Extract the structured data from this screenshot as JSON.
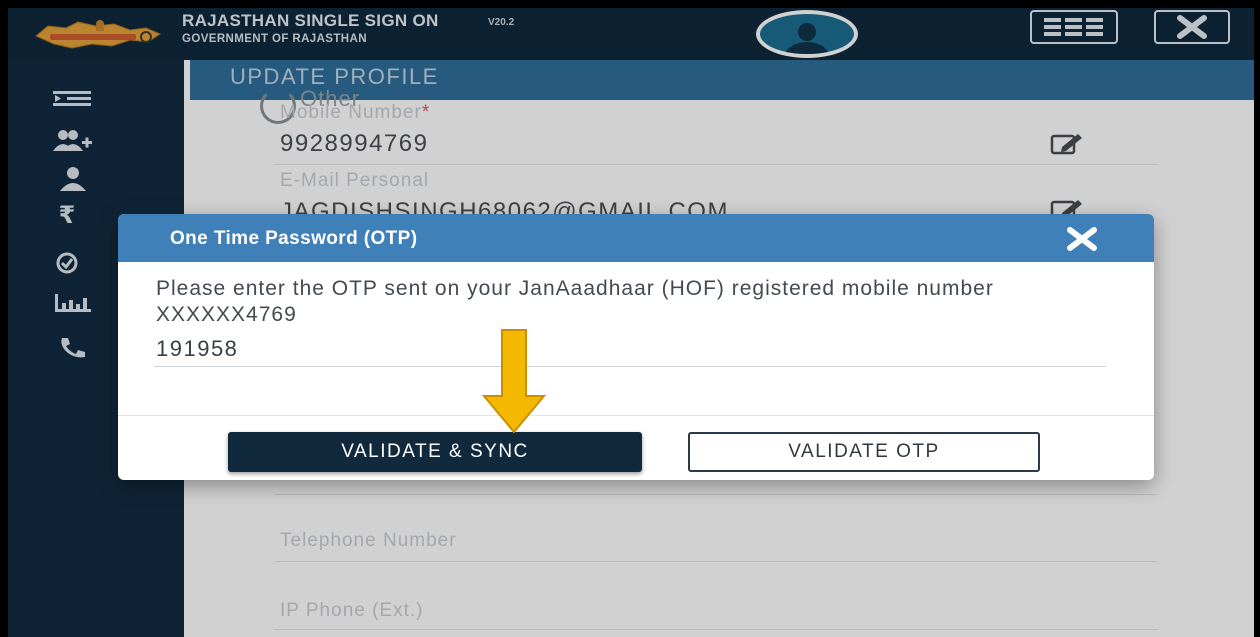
{
  "header": {
    "title": "RAJASTHAN SINGLE SIGN ON",
    "version": "V20.2",
    "subtitle": "GOVERNMENT OF RAJASTHAN",
    "apps_icon": "grid-icon",
    "close_icon": "close-icon"
  },
  "sidebar": {
    "items": [
      {
        "icon": "menu-icon"
      },
      {
        "icon": "add-user-icon"
      },
      {
        "icon": "user-icon"
      },
      {
        "icon": "rupee-icon"
      },
      {
        "icon": "check-circle-icon"
      },
      {
        "icon": "bar-chart-icon"
      },
      {
        "icon": "phone-icon"
      }
    ]
  },
  "page": {
    "title": "UPDATE PROFILE",
    "partial_text": "Other",
    "fields": {
      "mobile_label": "Mobile Number",
      "mobile_required": "*",
      "mobile_value": "9928994769",
      "email_label": "E-Mail Personal",
      "email_value": "JAGDISHSINGH68062@GMAIL.COM",
      "telephone_label": "Telephone Number",
      "ip_phone_label": "IP Phone (Ext.)"
    }
  },
  "dialog": {
    "title": "One Time Password (OTP)",
    "message": "Please enter the OTP sent on your JanAaadhaar (HOF) registered mobile number XXXXXX4769",
    "otp_value": "191958",
    "validate_sync_label": "VALIDATE & SYNC",
    "validate_otp_label": "VALIDATE OTP"
  },
  "colors": {
    "header_bg": "#0f2a3f",
    "dialog_header": "#3f80b9",
    "primary_button": "#11293d",
    "arrow": "#f5b800"
  }
}
